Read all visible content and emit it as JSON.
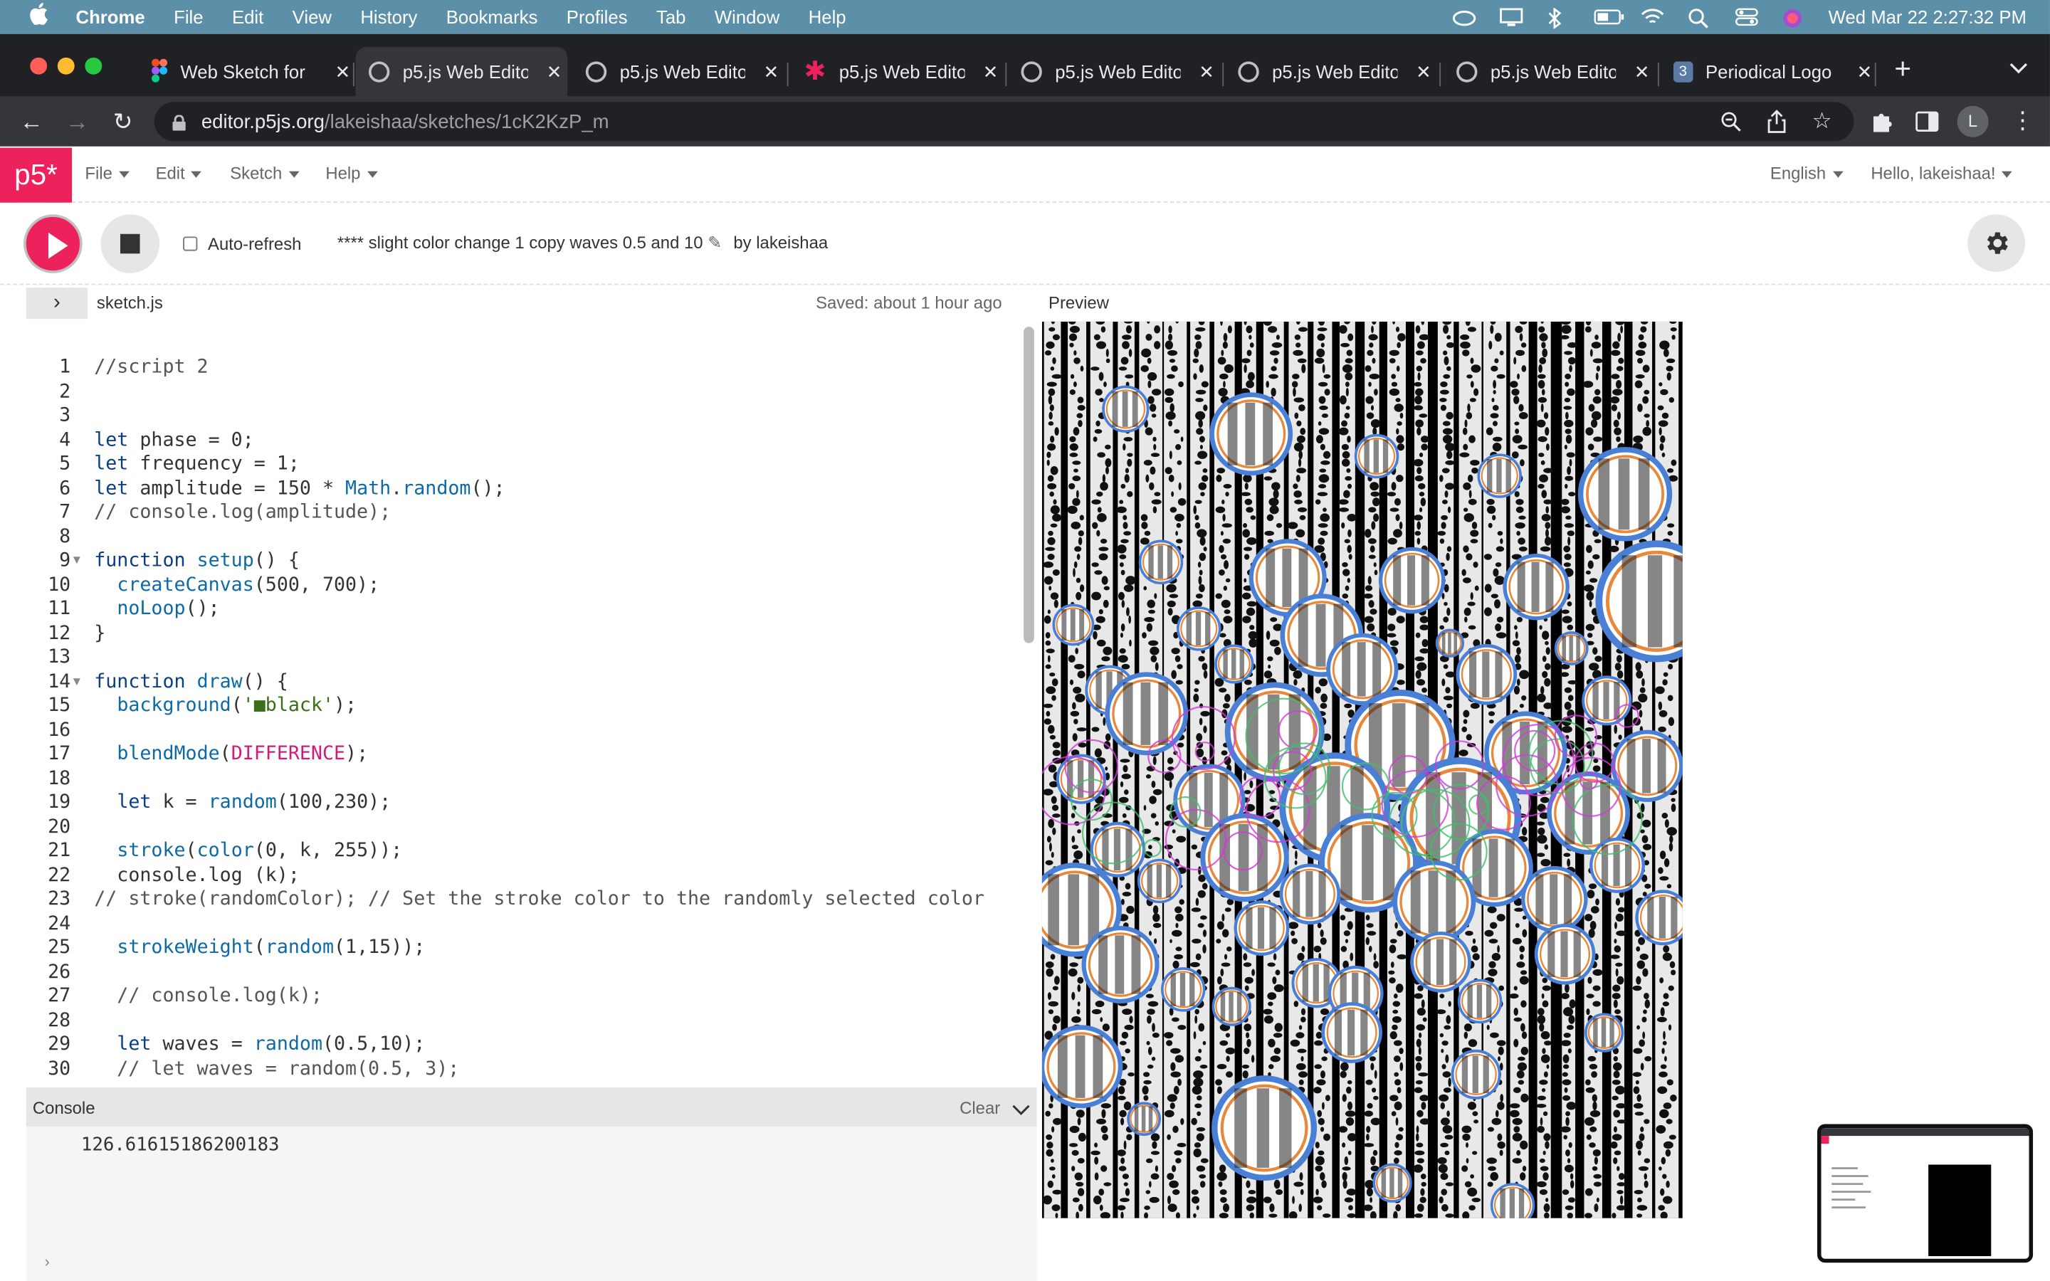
{
  "menubar": {
    "app": "Chrome",
    "items": [
      "File",
      "Edit",
      "View",
      "History",
      "Bookmarks",
      "Profiles",
      "Tab",
      "Window",
      "Help"
    ],
    "datetime": "Wed Mar 22  2:27:32 PM"
  },
  "tabs": [
    {
      "label": "Web Sketch for",
      "favicon": "figma-icon"
    },
    {
      "label": "p5.js Web Edito",
      "favicon": "globe-icon",
      "active": true
    },
    {
      "label": "p5.js Web Edito",
      "favicon": "globe-icon"
    },
    {
      "label": "p5.js Web Edito",
      "favicon": "asterisk-icon"
    },
    {
      "label": "p5.js Web Edito",
      "favicon": "globe-icon"
    },
    {
      "label": "p5.js Web Edito",
      "favicon": "globe-icon"
    },
    {
      "label": "p5.js Web Edito",
      "favicon": "globe-icon"
    },
    {
      "label": "Periodical Logo",
      "favicon": "numbered-3-icon"
    }
  ],
  "address": {
    "host": "editor.p5js.org",
    "path": "/lakeishaa/sketches/1cK2KzP_m"
  },
  "profile_initial": "L",
  "p5": {
    "logo": "p5*",
    "menus": [
      "File",
      "Edit",
      "Sketch",
      "Help"
    ],
    "language": "English",
    "greeting": "Hello, lakeishaa!",
    "autorefresh": "Auto-refresh",
    "sketch_name": "**** slight color change 1 copy waves 0.5 and 10",
    "by": "by lakeishaa",
    "file_name": "sketch.js",
    "saved": "Saved: about 1 hour ago",
    "preview_label": "Preview",
    "console_label": "Console",
    "clear_label": "Clear",
    "console_output": "126.61615186200183"
  },
  "code_lines": [
    "//script 2",
    "",
    "",
    "let phase = 0;",
    "let frequency = 1;",
    "let amplitude = 150 * Math.random();",
    "// console.log(amplitude);",
    "",
    "function setup() {",
    "  createCanvas(500, 700);",
    "  noLoop();",
    "}",
    "",
    "function draw() {",
    "  background('■black');",
    "",
    "  blendMode(DIFFERENCE);",
    "",
    "  let k = random(100,230);",
    "",
    "  stroke(color(0, k, 255));",
    "  console.log (k);",
    "// stroke(randomColor); // Set the stroke color to the randomly selected color",
    "",
    "  strokeWeight(random(1,15));",
    "",
    "  // console.log(k);",
    "",
    "  let waves = random(0.5,10);",
    "  // let waves = random(0.5, 3);"
  ],
  "colors": {
    "p5_pink": "#ED225D",
    "menubar": "#5C8FA8",
    "chrome_dark": "#202124"
  }
}
